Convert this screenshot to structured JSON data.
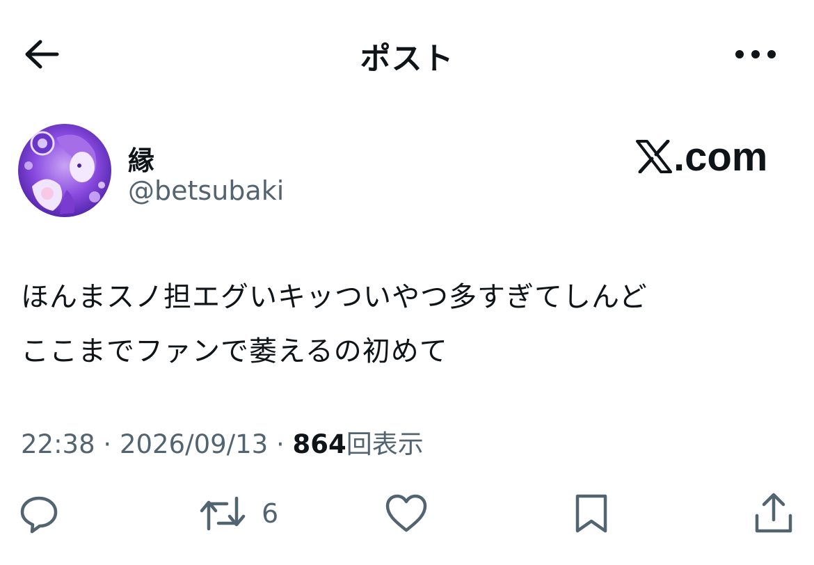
{
  "header": {
    "back_icon": "arrow-left-icon",
    "title": "ポスト",
    "more_icon": "ellipsis-horizontal-icon"
  },
  "author": {
    "display_name": "縁",
    "handle": "@betsubaki",
    "avatar": "avatar-image"
  },
  "watermark": {
    "text": ".com",
    "logo": "x-logo-icon"
  },
  "post": {
    "lines": [
      "ほんまスノ担エグいキッついやつ多すぎてしんど",
      "ここまでファンで萎えるの初めて"
    ]
  },
  "meta": {
    "time": "22:38",
    "separator": "·",
    "date": "2026/09/13",
    "views_count": "864",
    "views_label": "回表示"
  },
  "actions": {
    "reply_icon": "reply-icon",
    "repost_icon": "repost-icon",
    "repost_count": "6",
    "like_icon": "heart-icon",
    "bookmark_icon": "bookmark-icon",
    "share_icon": "share-icon"
  },
  "colors": {
    "text_primary": "#0f1419",
    "text_secondary": "#536471",
    "background": "#ffffff",
    "avatar_purple": "#7b3fd6"
  }
}
